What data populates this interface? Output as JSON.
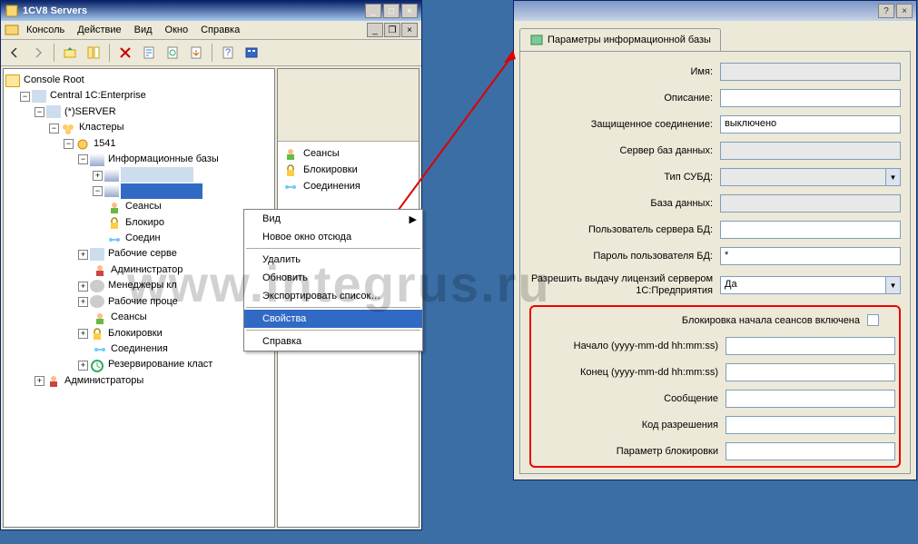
{
  "left_window": {
    "title": "1CV8 Servers",
    "menu": {
      "console": "Консоль",
      "action": "Действие",
      "view": "Вид",
      "window": "Окно",
      "help": "Справка"
    },
    "tree": {
      "root": "Console Root",
      "central": "Central 1C:Enterprise",
      "server": "(*)SERVER",
      "clusters": "Кластеры",
      "c1541": "1541",
      "infobases": "Информационные базы",
      "sessions": "Сеансы",
      "locks": "Блокиро",
      "connections": "Соедин",
      "workservers": "Рабочие серве",
      "admins_cluster": "Администратор",
      "managers": "Менеджеры кл",
      "workprocs": "Рабочие проце",
      "sessions2": "Сеансы",
      "locks2": "Блокировки",
      "connections2": "Соединения",
      "backup": "Резервирование класт",
      "admins": "Администраторы"
    },
    "list": {
      "sessions": "Сеансы",
      "locks": "Блокировки",
      "connections": "Соединения"
    },
    "ctx": {
      "view": "Вид",
      "newwin": "Новое окно отсюда",
      "delete": "Удалить",
      "refresh": "Обновить",
      "export": "Экспортировать список…",
      "props": "Свойства",
      "help": "Справка"
    }
  },
  "right_window": {
    "tab": "Параметры информационной базы",
    "fields": {
      "name": "Имя:",
      "desc": "Описание:",
      "secure": "Защищенное соединение:",
      "secure_val": "выключено",
      "dbserver": "Сервер баз данных:",
      "dbtype": "Тип СУБД:",
      "dbname": "База данных:",
      "dbuser": "Пользователь сервера БД:",
      "dbpass": "Пароль пользователя БД:",
      "dbpass_val": "*",
      "license": "Разрешить выдачу лицензий сервером 1С:Предприятия",
      "license_val": "Да",
      "block_enabled": "Блокировка начала сеансов включена",
      "start": "Начало (yyyy-mm-dd hh:mm:ss)",
      "end": "Конец (yyyy-mm-dd hh:mm:ss)",
      "message": "Сообщение",
      "permit_code": "Код разрешения",
      "block_param": "Параметр блокировки"
    }
  },
  "watermark": "www.integrus.ru"
}
